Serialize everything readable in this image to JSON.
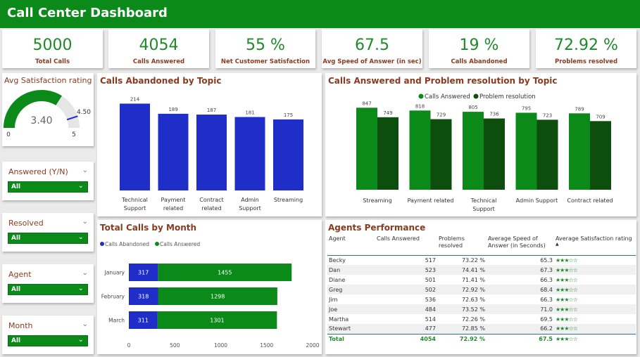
{
  "title": "Call Center Dashboard",
  "kpis": [
    {
      "value": "5000",
      "label": "Total Calls"
    },
    {
      "value": "4054",
      "label": "Calls Answered"
    },
    {
      "value": "55 %",
      "label": "Net Customer Satisfaction"
    },
    {
      "value": "67.5",
      "label": "Avg Speed of Answer (in sec)"
    },
    {
      "value": "19 %",
      "label": "Calls Abandoned"
    },
    {
      "value": "72.92 %",
      "label": "Problems resolved"
    }
  ],
  "gauge": {
    "title": "Avg Satisfaction rating",
    "value": 3.4,
    "value_label": "3.40",
    "min": 0,
    "min_label": "0",
    "max": 5,
    "max_label": "5",
    "target": 4.5,
    "target_label": "4.50"
  },
  "slicers": [
    {
      "title": "Answered (Y/N)",
      "value": "All"
    },
    {
      "title": "Resolved",
      "value": "All"
    },
    {
      "title": "Agent",
      "value": "All"
    },
    {
      "title": "Month",
      "value": "All"
    }
  ],
  "colors": {
    "header": "#0b8a1a",
    "kpi_value": "#1e8a2a",
    "title": "#8b3a1f",
    "abandoned": "#1f2ec9",
    "answered": "#0b8a1a",
    "resolution": "#0d4d0d"
  },
  "chart_data": [
    {
      "type": "bar",
      "title": "Calls Abandoned by Topic",
      "categories": [
        "Technical Support",
        "Payment related",
        "Contract related",
        "Admin Support",
        "Streaming"
      ],
      "category_lines": [
        [
          "Technical",
          "Support"
        ],
        [
          "Payment",
          "related"
        ],
        [
          "Contract",
          "related"
        ],
        [
          "Admin",
          "Support"
        ],
        [
          "Streaming"
        ]
      ],
      "values": [
        214,
        189,
        187,
        181,
        175
      ],
      "ylim": [
        0,
        220
      ]
    },
    {
      "type": "bar",
      "title": "Calls Answered and Problem resolution by Topic",
      "categories": [
        "Streaming",
        "Payment related",
        "Technical Support",
        "Admin Support",
        "Contract related"
      ],
      "category_lines": [
        [
          "Streaming"
        ],
        [
          "Payment related"
        ],
        [
          "Technical",
          "Support"
        ],
        [
          "Admin Support"
        ],
        [
          "Contract related"
        ]
      ],
      "series": [
        {
          "name": "Calls Answered",
          "values": [
            847,
            818,
            805,
            795,
            789
          ]
        },
        {
          "name": "Problem resolution",
          "values": [
            749,
            729,
            736,
            723,
            709
          ]
        }
      ],
      "legend": "top-center",
      "ylim": [
        0,
        900
      ]
    },
    {
      "type": "bar",
      "orientation": "horizontal",
      "stacked": true,
      "title": "Total Calls by Month",
      "categories": [
        "January",
        "February",
        "March"
      ],
      "series": [
        {
          "name": "Calls Abandoned",
          "values": [
            317,
            318,
            311
          ]
        },
        {
          "name": "Calls Answered",
          "values": [
            1455,
            1298,
            1301
          ]
        }
      ],
      "xticks": [
        0,
        500,
        1000,
        1500,
        2000
      ],
      "xlim": [
        0,
        2000
      ],
      "legend": "top-left"
    }
  ],
  "agents": {
    "title": "Agents Performance",
    "columns": [
      "Agent",
      "Calls Answered",
      "Problems resolved",
      "Average Speed of Answer (in Seconds)",
      "Average Satisfaction rating"
    ],
    "rows": [
      {
        "agent": "Becky",
        "calls": "517",
        "resolved": "73.22 %",
        "speed": "65.3",
        "stars": "★★★☆☆"
      },
      {
        "agent": "Dan",
        "calls": "523",
        "resolved": "74.41 %",
        "speed": "67.3",
        "stars": "★★★☆☆"
      },
      {
        "agent": "Diane",
        "calls": "501",
        "resolved": "71.41 %",
        "speed": "66.3",
        "stars": "★★★☆☆"
      },
      {
        "agent": "Greg",
        "calls": "502",
        "resolved": "72.92 %",
        "speed": "68.4",
        "stars": "★★★☆☆"
      },
      {
        "agent": "Jim",
        "calls": "536",
        "resolved": "72.63 %",
        "speed": "66.3",
        "stars": "★★★☆☆"
      },
      {
        "agent": "Joe",
        "calls": "484",
        "resolved": "73.52 %",
        "speed": "71.0",
        "stars": "★★★☆☆"
      },
      {
        "agent": "Martha",
        "calls": "514",
        "resolved": "72.26 %",
        "speed": "69.5",
        "stars": "★★★☆☆"
      },
      {
        "agent": "Stewart",
        "calls": "477",
        "resolved": "72.85 %",
        "speed": "66.2",
        "stars": "★★★☆☆"
      }
    ],
    "total": {
      "agent": "Total",
      "calls": "4054",
      "resolved": "72.92 %",
      "speed": "67.5",
      "stars": "★★★☆☆"
    }
  }
}
